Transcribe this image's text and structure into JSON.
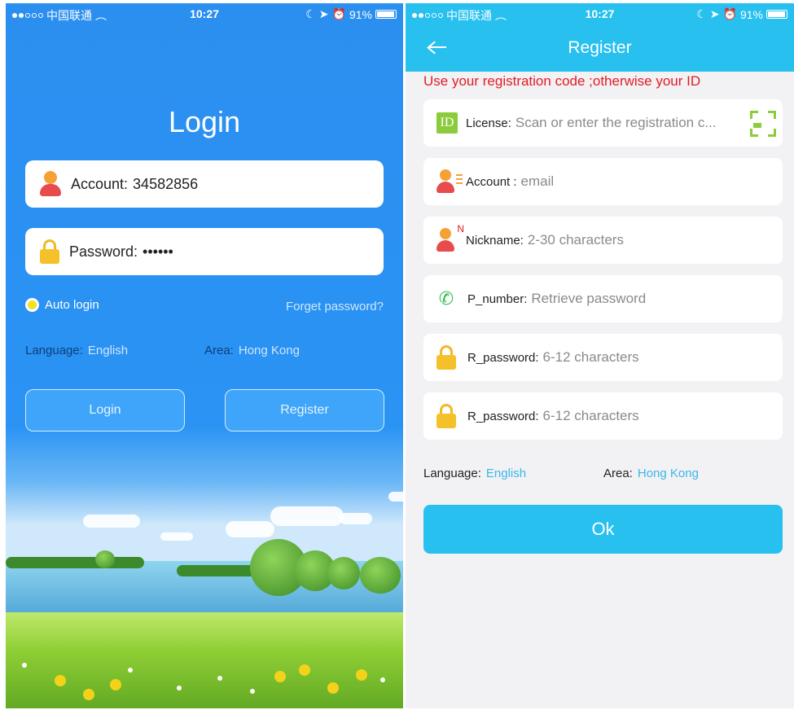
{
  "login_screen": {
    "status": {
      "carrier": "中国联通",
      "time": "10:27",
      "battery": "91%"
    },
    "title": "Login",
    "account_field": {
      "label": "Account:",
      "value": "34582856"
    },
    "password_field": {
      "label": "Password:",
      "value": "••••••"
    },
    "auto_login_label": "Auto login",
    "forget_password": "Forget password?",
    "language_key": "Language:",
    "language_value": "English",
    "area_key": "Area:",
    "area_value": "Hong Kong",
    "login_button": "Login",
    "register_button": "Register"
  },
  "register_screen": {
    "status": {
      "carrier": "中国联通",
      "time": "10:27",
      "battery": "91%"
    },
    "title": "Register",
    "notice": "Use your registration code ;otherwise your ID",
    "fields": [
      {
        "icon": "id-icon",
        "label": "License:",
        "placeholder": "Scan or enter the registration c..."
      },
      {
        "icon": "account-icon",
        "label": "Account :",
        "placeholder": "email"
      },
      {
        "icon": "nickname-icon",
        "label": "Nickname:",
        "placeholder": "2-30 characters"
      },
      {
        "icon": "phone-icon",
        "label": "P_number:",
        "placeholder": "Retrieve password"
      },
      {
        "icon": "lock-icon",
        "label": "R_password:",
        "placeholder": "6-12 characters"
      },
      {
        "icon": "lock-icon",
        "label": "R_password:",
        "placeholder": "6-12 characters"
      }
    ],
    "language_key": "Language:",
    "language_value": "English",
    "area_key": "Area:",
    "area_value": "Hong Kong",
    "ok_button": "Ok",
    "id_icon_text": "ID",
    "nickname_badge": "N"
  },
  "colors": {
    "login_bg": "#2a93f3",
    "header_bg": "#27c0ef",
    "notice_red": "#e31b23",
    "link_blue": "#3bb6ea",
    "icon_green": "#8ccc3c"
  }
}
